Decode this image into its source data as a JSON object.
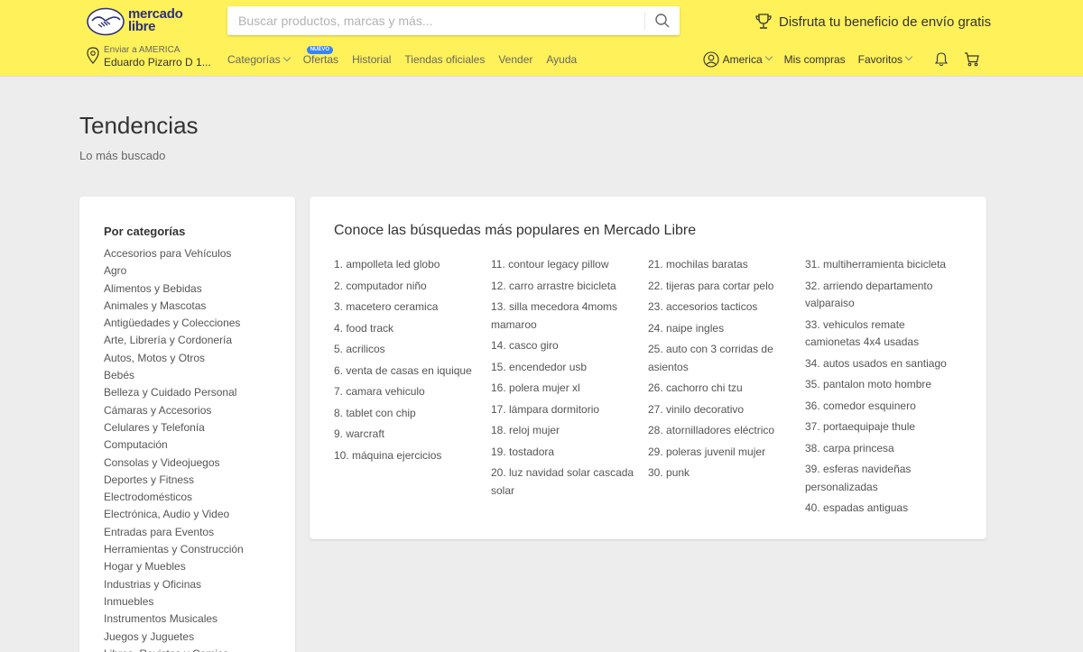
{
  "header": {
    "logo_text_line1": "mercado",
    "logo_text_line2": "libre",
    "search_placeholder": "Buscar productos, marcas y más...",
    "promo_text": "Disfruta tu beneficio de envío gratis",
    "address_small": "Enviar a AMERICA",
    "address_big": "Eduardo Pizarro D 1...",
    "nav": {
      "categorias": "Categorías",
      "ofertas": "Ofertas",
      "ofertas_badge": "NUEVO",
      "historial": "Historial",
      "tiendas": "Tiendas oficiales",
      "vender": "Vender",
      "ayuda": "Ayuda"
    },
    "user": "America",
    "compras": "Mis compras",
    "favoritos": "Favoritos"
  },
  "page": {
    "title": "Tendencias",
    "subtitle": "Lo más buscado"
  },
  "sidebar": {
    "title": "Por categorías",
    "items": [
      "Accesorios para Vehículos",
      "Agro",
      "Alimentos y Bebidas",
      "Animales y Mascotas",
      "Antigüedades y Colecciones",
      "Arte, Librería y Cordonería",
      "Autos, Motos y Otros",
      "Bebés",
      "Belleza y Cuidado Personal",
      "Cámaras y Accesorios",
      "Celulares y Telefonía",
      "Computación",
      "Consolas y Videojuegos",
      "Deportes y Fitness",
      "Electrodomésticos",
      "Electrónica, Audio y Video",
      "Entradas para Eventos",
      "Herramientas y Construcción",
      "Hogar y Muebles",
      "Industrias y Oficinas",
      "Inmuebles",
      "Instrumentos Musicales",
      "Juegos y Juguetes",
      "Libros, Revistas y Comics"
    ]
  },
  "trends": {
    "title": "Conoce las búsquedas más populares en Mercado Libre",
    "columns": [
      [
        "1. ampolleta led globo",
        "2. computador niño",
        "3. macetero ceramica",
        "4. food track",
        "5. acrilicos",
        "6. venta de casas en iquique",
        "7. camara vehiculo",
        "8. tablet con chip",
        "9. warcraft",
        "10. máquina ejercicios"
      ],
      [
        "11. contour legacy pillow",
        "12. carro arrastre bicicleta",
        "13. silla mecedora 4moms mamaroo",
        "14. casco giro",
        "15. encendedor usb",
        "16. polera mujer xl",
        "17. lámpara dormitorio",
        "18. reloj mujer",
        "19. tostadora",
        "20. luz navidad solar cascada solar"
      ],
      [
        "21. mochilas baratas",
        "22. tijeras para cortar pelo",
        "23. accesorios tacticos",
        "24. naipe ingles",
        "25. auto con 3 corridas de asientos",
        "26. cachorro chi tzu",
        "27. vinilo decorativo",
        "28. atornilladores eléctrico",
        "29. poleras juvenil mujer",
        "30. punk"
      ],
      [
        "31. multiherramienta bicicleta",
        "32. arriendo departamento valparaiso",
        "33. vehiculos remate camionetas 4x4 usadas",
        "34. autos usados en santiago",
        "35. pantalon moto hombre",
        "36. comedor esquinero",
        "37. portaequipaje thule",
        "38. carpa princesa",
        "39. esferas navideñas personalizadas",
        "40. espadas antiguas"
      ]
    ]
  }
}
